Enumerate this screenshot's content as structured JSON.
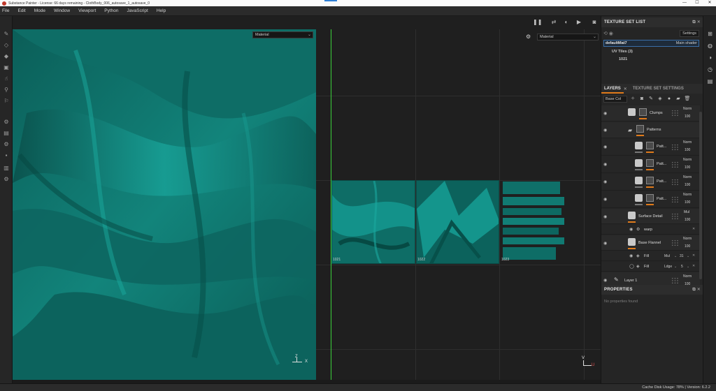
{
  "window": {
    "title": "Substance Painter - License: 66 days remaining - ClothBody_006_autosave_1_autosave_0",
    "controls": [
      "—",
      "☐",
      "✕"
    ]
  },
  "menu": [
    "File",
    "Edit",
    "Mode",
    "Window",
    "Viewport",
    "Python",
    "JavaScript",
    "Help"
  ],
  "viewport3d": {
    "channel_select": "Material",
    "gizmo": {
      "z": "Z",
      "x": "X"
    }
  },
  "viewport2d": {
    "channel_select": "Material",
    "tiles": [
      "1021",
      "1022",
      "1023"
    ],
    "gizmo": {
      "v": "V",
      "u": "U"
    }
  },
  "texture_set_list": {
    "header": "TEXTURE SET LIST",
    "settings_label": "Settings",
    "material_name": "defaultMat7",
    "shader": "Main shader",
    "uv_tiles": "UV Tiles (3)",
    "tile": "1021"
  },
  "tabs": {
    "layers": "LAYERS",
    "texture_set_settings": "TEXTURE SET SETTINGS"
  },
  "layer_toolbar": {
    "channel": "Base Col"
  },
  "layers": [
    {
      "name": "Clumps",
      "blend": "Norm",
      "opacity": "100"
    },
    {
      "name": "Patterns",
      "blend": "",
      "opacity": ""
    },
    {
      "name": "Patt...",
      "blend": "Norm",
      "opacity": "100"
    },
    {
      "name": "Patt...",
      "blend": "Norm",
      "opacity": "100"
    },
    {
      "name": "Patt...",
      "blend": "Norm",
      "opacity": "100"
    },
    {
      "name": "Patt...",
      "blend": "Norm",
      "opacity": "100"
    },
    {
      "name": "Surface Detail",
      "blend": "Mul",
      "opacity": "100"
    },
    {
      "name": "warp",
      "blend": "",
      "opacity": ""
    },
    {
      "name": "Base Flannel",
      "blend": "Norm",
      "opacity": "100"
    },
    {
      "name": "Fill",
      "blend": "Mul",
      "opacity": "31"
    },
    {
      "name": "Fill",
      "blend": "Ldge",
      "opacity": "5"
    },
    {
      "name": "Layer 1",
      "blend": "Norm",
      "opacity": "100"
    }
  ],
  "properties": {
    "header": "PROPERTIES",
    "empty": "No properties found"
  },
  "status": {
    "text": "Cache Disk Usage: 78% | Version: 6.2.2"
  },
  "colors": {
    "accent": "#e07a1a",
    "fabric": "#0f6f68",
    "uv_axis": "#3bd13b"
  }
}
